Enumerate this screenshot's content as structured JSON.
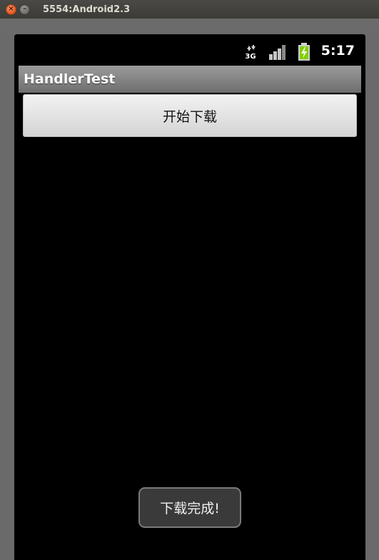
{
  "window": {
    "title": "5554:Android2.3",
    "close_glyph": "×",
    "minimize_glyph": "–"
  },
  "statusbar": {
    "time": "5:17",
    "network_label": "3G",
    "icons": [
      "network-3g-icon",
      "signal-strength-icon",
      "battery-charging-icon"
    ]
  },
  "app": {
    "title": "HandlerTest",
    "download_button_label": "开始下载",
    "toast_text": "下载完成!"
  },
  "colors": {
    "battery_fill": "#7fd000",
    "screen_background": "#000000",
    "titlebar_close": "#e2561f"
  }
}
